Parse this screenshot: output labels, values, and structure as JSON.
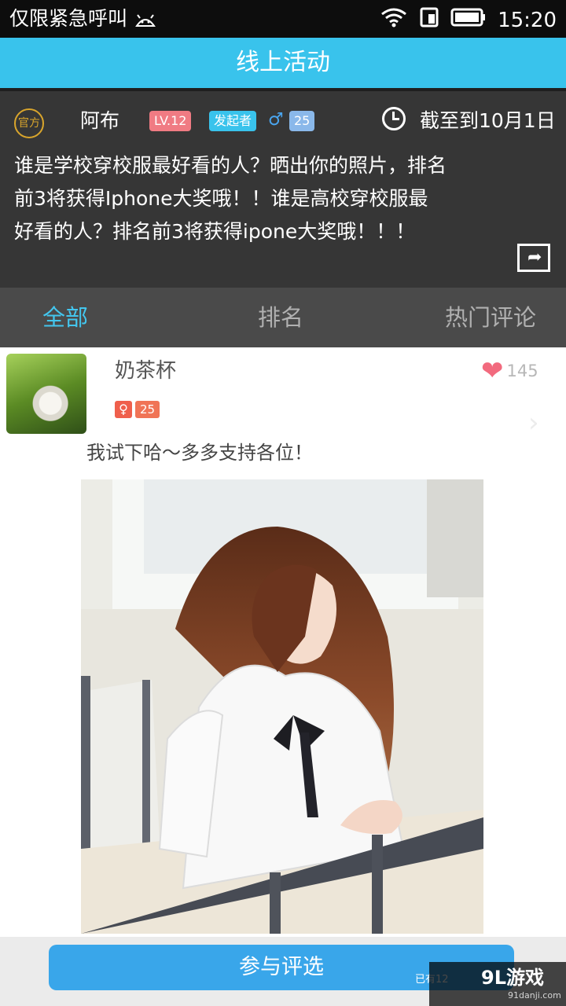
{
  "status_bar": {
    "left_text": "仅限紧急呼叫",
    "time": "15:20",
    "icons": [
      "android-icon",
      "wifi-icon",
      "sim-icon",
      "battery-icon"
    ]
  },
  "header": {
    "title": "线上活动"
  },
  "activity": {
    "official_badge": "官方",
    "author": "阿布",
    "level": "LV.12",
    "role": "发起者",
    "gender_symbol": "♂",
    "age": "25",
    "deadline": "截至到10月1日",
    "description": "谁是学校穿校服最好看的人？晒出你的照片，排名\n前3将获得Iphone大奖哦！！谁是高校穿校服最\n好看的人？排名前3将获得ipone大奖哦！！！"
  },
  "tabs": [
    {
      "label": "全部",
      "active": true
    },
    {
      "label": "排名",
      "active": false
    },
    {
      "label": "热门评论",
      "active": false
    }
  ],
  "post": {
    "username": "奶茶杯",
    "gender_symbol": "♀",
    "age": "25",
    "likes": "145",
    "comment": "我试下哈～多多支持各位！"
  },
  "bottom": {
    "participate_label": "参与评选",
    "count_text": "已有12"
  },
  "watermark": {
    "logo_text": "9L游戏",
    "site_text": "91danji.com"
  },
  "colors": {
    "accent_blue": "#39c3ec",
    "dark_panel": "#363636",
    "heart": "#f26a7e"
  }
}
